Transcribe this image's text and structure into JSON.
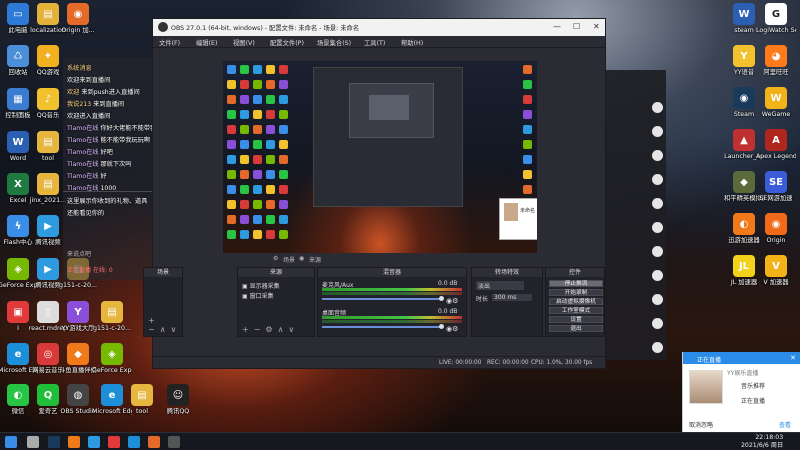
{
  "desktop": {
    "left_icons": [
      {
        "label": "此电脑",
        "color": "#2d7bd6",
        "glyph": "▭"
      },
      {
        "label": "localization",
        "color": "#e2b23a",
        "glyph": "▤"
      },
      {
        "label": "Origin 加...",
        "color": "#e46a2a",
        "glyph": "◉"
      },
      {
        "label": "回收站",
        "color": "#4a8fd8",
        "glyph": "♺"
      },
      {
        "label": "QQ游戏",
        "color": "#f0b020",
        "glyph": "✦"
      },
      {
        "label": "控制面板",
        "color": "#3a7cd0",
        "glyph": "▦"
      },
      {
        "label": "QQ音乐",
        "color": "#f2c12e",
        "glyph": "♪"
      },
      {
        "label": "Word",
        "color": "#2b5fb3",
        "glyph": "W"
      },
      {
        "label": "tool",
        "color": "#e6b63f",
        "glyph": "▤"
      },
      {
        "label": "Excel",
        "color": "#1e7a3e",
        "glyph": "X"
      },
      {
        "label": "jinx_2021...",
        "color": "#e6b63f",
        "glyph": "▤"
      },
      {
        "label": "Flash中心",
        "color": "#3b8ee8",
        "glyph": "ϟ"
      },
      {
        "label": "腾讯视频",
        "color": "#2e9be0",
        "glyph": "▶"
      },
      {
        "label": "GeForce Experience",
        "color": "#76b900",
        "glyph": "◈"
      },
      {
        "label": "腾讯视频",
        "color": "#2e9be0",
        "glyph": "▶"
      },
      {
        "label": "g151-c-20...",
        "color": "#e6b63f",
        "glyph": "▤"
      },
      {
        "label": "I",
        "color": "#e23a3a",
        "glyph": "▣"
      },
      {
        "label": "react.mdrep",
        "color": "#dddddd",
        "glyph": "▯"
      },
      {
        "label": "YY游戏大厅",
        "color": "#8a4fd8",
        "glyph": "Y"
      },
      {
        "label": "g151-c-20...",
        "color": "#e6b63f",
        "glyph": "▤"
      },
      {
        "label": "Microsoft Edge",
        "color": "#1d8fd8",
        "glyph": "e"
      },
      {
        "label": "网易云音乐",
        "color": "#d83a3a",
        "glyph": "◎"
      },
      {
        "label": "斗鱼直播伴侣",
        "color": "#f07a1a",
        "glyph": "◆"
      },
      {
        "label": "GeForce Experience",
        "color": "#76b900",
        "glyph": "◈"
      },
      {
        "label": "微信",
        "color": "#28c445",
        "glyph": "◐"
      },
      {
        "label": "爱奇艺",
        "color": "#1fbf3a",
        "glyph": "Q"
      },
      {
        "label": "OBS Studio",
        "color": "#444444",
        "glyph": "◍"
      },
      {
        "label": "Microsoft Edge",
        "color": "#1d8fd8",
        "glyph": "e"
      },
      {
        "label": "tool",
        "color": "#e6b63f",
        "glyph": "▤"
      },
      {
        "label": "腾讯QQ",
        "color": "#222222",
        "glyph": "☺"
      }
    ],
    "right_icons": [
      {
        "label": "steam",
        "color": "#2b5fb3",
        "glyph": "W"
      },
      {
        "label": "LogiWatch Setup",
        "color": "#ffffff",
        "glyph": "G"
      },
      {
        "label": "YY语音",
        "color": "#f2c12e",
        "glyph": "Y"
      },
      {
        "label": "阿里旺旺",
        "color": "#ff7a1a",
        "glyph": "◕"
      },
      {
        "label": "Steam",
        "color": "#1a3a5c",
        "glyph": "◉"
      },
      {
        "label": "WeGame",
        "color": "#f2b31a",
        "glyph": "W"
      },
      {
        "label": "Launcher_cn",
        "color": "#c03030",
        "glyph": "▲"
      },
      {
        "label": "Apex Legends",
        "color": "#b0261f",
        "glyph": "A"
      },
      {
        "label": "和平精英模拟器",
        "color": "#5a6a3a",
        "glyph": "◆"
      },
      {
        "label": "SE网游加速",
        "color": "#3b5bd8",
        "glyph": "SE"
      },
      {
        "label": "迅游加速器",
        "color": "#f07a1a",
        "glyph": "◐"
      },
      {
        "label": "Origin",
        "color": "#f06a1a",
        "glyph": "◉"
      },
      {
        "label": "JL 加速器",
        "color": "#f2d21a",
        "glyph": "JL"
      },
      {
        "label": "V 加速器",
        "color": "#f2b31a",
        "glyph": "V"
      }
    ]
  },
  "chat": {
    "messages": [
      {
        "tag": "系统消息",
        "text": ""
      },
      {
        "tag": "",
        "text": "欢迎来到直播间"
      },
      {
        "tag": "欢迎",
        "text": "来到push进入直播间"
      },
      {
        "tag": "我说213",
        "text": "来到直播间"
      },
      {
        "tag": "",
        "text": "欢迎进入直播间"
      },
      {
        "tag": "Tlamo在线",
        "text": "你好大佬能不能带我玩玩呀"
      },
      {
        "tag": "Tlamo在线",
        "text": "能不能带我玩玩啊"
      },
      {
        "tag": "Tlamo在线",
        "text": "好吧"
      },
      {
        "tag": "Tlamo在线",
        "text": "那就下次吗"
      },
      {
        "tag": "Tlamo在线",
        "text": "好"
      },
      {
        "tag": "Tlamo在线",
        "text": "1000"
      }
    ],
    "note1": "这里展示你收到的礼物、道具",
    "note2": "还能看见你的",
    "input_placeholder": "来说点吧",
    "status": "正在直播",
    "count": "在线: 0"
  },
  "obs": {
    "title": "OBS 27.0.1 (64-bit, windows) - 配置文件: 未命名 - 场景: 未命名",
    "menu": [
      "文件(F)",
      "编辑(E)",
      "视图(V)",
      "配置文件(P)",
      "场景集合(S)",
      "工具(T)",
      "帮助(H)"
    ],
    "scenes_header": "场景",
    "sources_header": "来源",
    "sources": [
      "显示器采集",
      "窗口采集"
    ],
    "mixer_header": "混音器",
    "mixer": [
      {
        "name": "麦克风/Aux",
        "level": "0.0 dB"
      },
      {
        "name": "桌面音频",
        "level": "0.0 dB"
      }
    ],
    "transition_header": "转场特效",
    "transition": {
      "type": "淡出",
      "duration_label": "时长",
      "duration": "300 ms"
    },
    "controls_header": "控件",
    "controls": [
      "停止推流",
      "开始录制",
      "启动虚拟摄像机",
      "工作室模式",
      "设置",
      "退出"
    ],
    "live": "LIVE: 00:00:00",
    "rec": "REC: 00:00:00",
    "cpu": "CPU: 1.0%, 30.00 fps",
    "scene_label": "场景",
    "source_label": "来源",
    "mini_label": "未命名"
  },
  "notification": {
    "title": "正在直播",
    "name": "YY娱乐直播",
    "line1": "音乐推荐",
    "line2": "正在直播",
    "ignore": "取消忽略",
    "view": "查看"
  },
  "taskbar": {
    "time": "22:18:03",
    "date": "2021/6/6 周日"
  }
}
